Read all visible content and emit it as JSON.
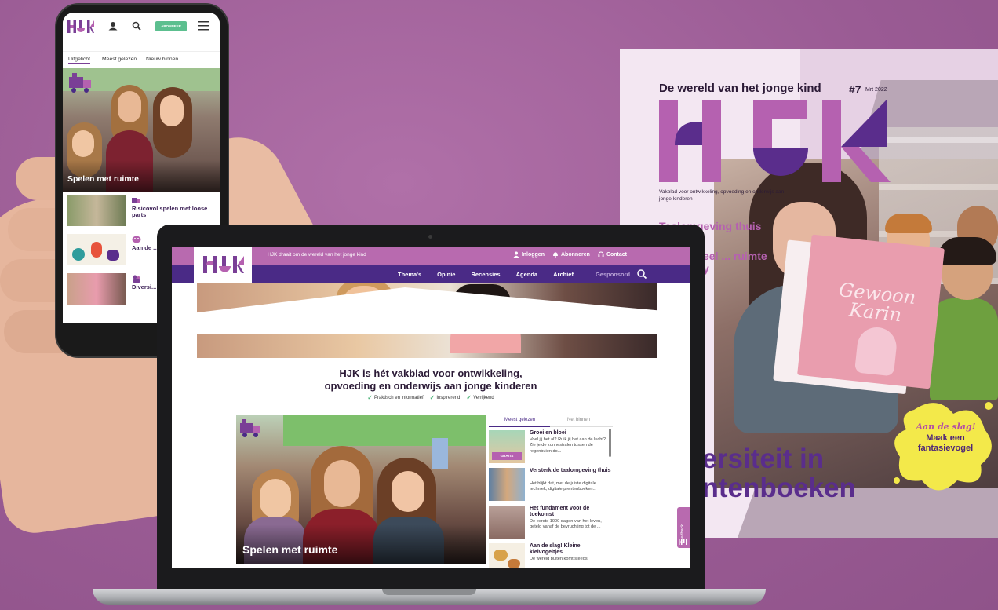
{
  "magazine": {
    "tagline": "De wereld van het jonge kind",
    "issue": "#7",
    "date": "Mrt 2022",
    "logo_text": "HJK",
    "subtitle": "Vakblad voor ontwikkeling, opvoeding en onderwijs aan jonge kinderen",
    "cover_lines": [
      "Taalomgeving thuis en ...",
      "Emotioneel ... ruimte ... agency"
    ],
    "book_title": "Gewoon Karin",
    "headline": "Diversiteit in prentenboeken",
    "splash_line1": "Aan de slag!",
    "splash_line2": "Maak een fantasievogel",
    "colors": {
      "brand_purple": "#5a2d8c",
      "brand_pink": "#b561b0",
      "splash_yellow": "#f3e94a"
    }
  },
  "phone": {
    "logo_text": "HJK",
    "subscribe_label": "ABONNEER",
    "tabs": [
      {
        "label": "Uitgelicht",
        "active": true
      },
      {
        "label": "Meest gelezen",
        "active": false
      },
      {
        "label": "Nieuw binnen",
        "active": false
      }
    ],
    "hero_title": "Spelen met ruimte",
    "items": [
      {
        "title": "Risicovol spelen met loose parts",
        "icon": "train-icon"
      },
      {
        "title": "Aan de ... in kuns...",
        "icon": "palette-icon"
      },
      {
        "title": "Diversi... prenter...",
        "icon": "people-icon"
      }
    ]
  },
  "laptop": {
    "logo_text": "HJK",
    "claim": "HJK draait om de wereld van het jonge kind",
    "top_links": {
      "login": "Inloggen",
      "subscribe": "Abonneren",
      "contact": "Contact"
    },
    "nav": [
      "Thema's",
      "Opinie",
      "Recensies",
      "Agenda",
      "Archief"
    ],
    "nav_sponsored": "Gesponsord",
    "headline_line1": "HJK is hét vakblad voor ontwikkeling,",
    "headline_line2": "opvoeding en onderwijs aan jonge kinderen",
    "checks": [
      "Praktisch en informatief",
      "Inspirerend",
      "Verrijkend"
    ],
    "feature_title": "Spelen met ruimte",
    "side_tabs": {
      "active": "Meest gelezen",
      "inactive": "Net binnen"
    },
    "side_items": [
      {
        "title": "Groei en bloei",
        "text": "Voel jij het al? Ruik jij het aan de lucht? Zie je de zonnestralen tussen de regenbuien do...",
        "badge": "GRATIS"
      },
      {
        "title": "Versterk de taalomgeving thuis",
        "text": "Het blijkt dat, met de juiste digitale techniek, digitale prentenboeken..."
      },
      {
        "title": "Het fundament voor de toekomst",
        "text": "De eerste 1000 dagen van het leven, geteld vanaf de bevruchting tot de ..."
      },
      {
        "title": "Aan de slag! Kleine kleivogeltjes",
        "text": "De wereld buiten komt steeds"
      }
    ],
    "feedback_label": "Feedback",
    "colors": {
      "topbar": "#b86aaf",
      "navbar": "#4a2a86",
      "check_green": "#4fb47a"
    }
  }
}
